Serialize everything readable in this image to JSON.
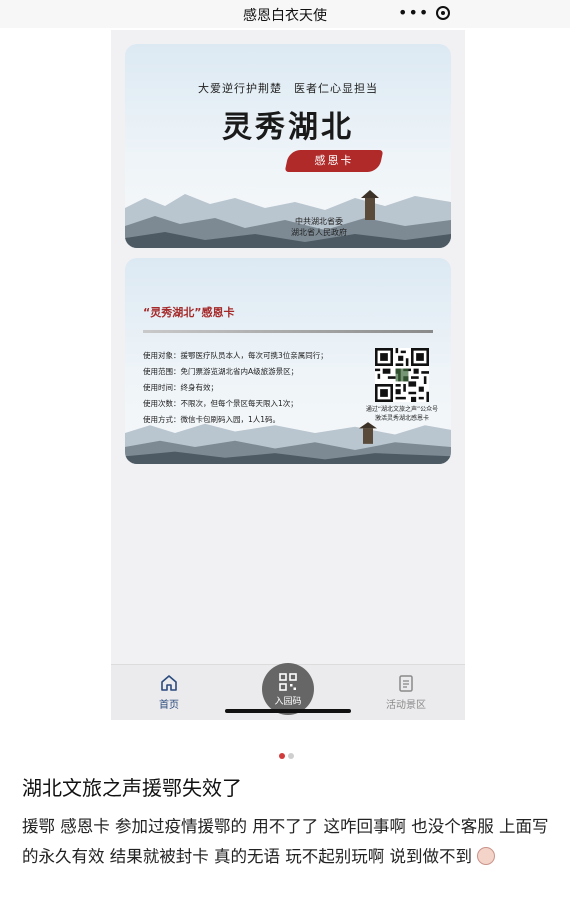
{
  "topbar": {
    "title": "感恩白衣天使",
    "more": "•••"
  },
  "card1": {
    "slogan": "大爱逆行护荆楚　医者仁心显担当",
    "title": "灵秀湖北",
    "badge": "感恩卡",
    "issuer_line1": "中共湖北省委",
    "issuer_line2": "湖北省人民政府"
  },
  "card2": {
    "title": "“灵秀湖北”感恩卡",
    "info": [
      "使用对象：援鄂医疗队员本人，每次可携3位亲属同行；",
      "使用范围：免门票游览湖北省内A级旅游景区；",
      "使用时间：终身有效；",
      "使用次数：不限次，但每个景区每天限入1次；",
      "使用方式：微信卡包刷码入园，1人1码。"
    ],
    "qr_caption_1": "通过“湖北文旅之声”公众号",
    "qr_caption_2": "激活灵秀湖北感恩卡"
  },
  "tabbar": {
    "home": "首页",
    "qr": "入园码",
    "activity": "活动景区"
  },
  "post": {
    "title": "湖北文旅之声援鄂失效了",
    "body": "援鄂 感恩卡 参加过疫情援鄂的 用不了了 这咋回事啊 也没个客服 上面写的永久有效 结果就被封卡 真的无语 玩不起别玩啊 说到做不到"
  },
  "colors": {
    "accent_red": "#b02a2a",
    "tab_active": "#2b4b7e"
  }
}
